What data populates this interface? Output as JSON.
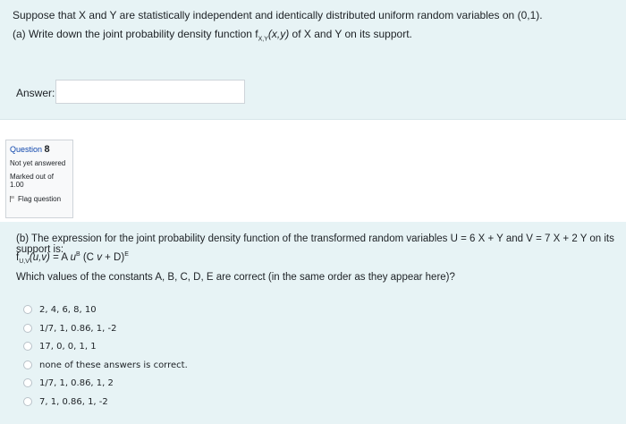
{
  "question1": {
    "line1": "Suppose that X and Y are statistically independent and identically distributed uniform random variables on (0,1).",
    "line2_pre": "(a) Write down the joint probability density function f",
    "line2_sub": "X,Y",
    "line2_arg": "(x,y)",
    "line2_post": " of X and Y on its support.",
    "answer_label": "Answer:",
    "answer_value": ""
  },
  "question_info": {
    "label": "Question",
    "number": "8",
    "state": "Not yet answered",
    "mark": "Marked out of 1.00",
    "flag_label": "Flag question"
  },
  "question2": {
    "line1": "(b) The expression for the joint probability density function of the transformed random variables U = 6 X + Y and V = 7 X + 2 Y on its support is:",
    "formula": {
      "f": "f",
      "sub": "U,V",
      "args": "(u,v)",
      "eq": " = A ",
      "u": "u",
      "supB": "B",
      "mid": " (C ",
      "v": "v",
      "end": " + D)",
      "supE": "E"
    },
    "prompt": "Which values of the constants A, B, C, D, E are correct (in the same order as they appear here)?",
    "options": [
      "2, 4, 6, 8, 10",
      "1/7, 1, 0.86, 1, -2",
      "17, 0, 0, 1, 1",
      "none of these answers is correct.",
      "1/7, 1, 0.86, 1, 2",
      "7, 1, 0.86, 1, -2"
    ]
  }
}
